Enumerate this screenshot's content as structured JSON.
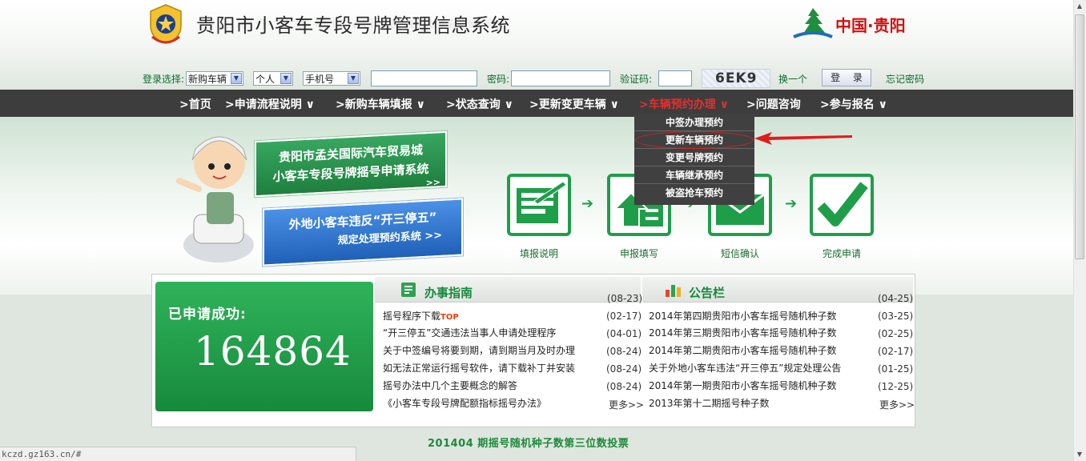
{
  "header": {
    "title": "贵阳市小客车专段号牌管理信息系统",
    "logo_text": "中国·贵阳",
    "icons": [
      "police-emblem-icon",
      "guiyang-logo-icon"
    ]
  },
  "login": {
    "select_label": "登录选择:",
    "vehicle_type": "新购车辆",
    "person_type": "个人",
    "id_type": "手机号",
    "password_label": "密码:",
    "captcha_label": "验证码:",
    "captcha_text": "6EK9",
    "refresh_label": "换一个",
    "login_button": "登 录",
    "forgot_label": "忘记密码"
  },
  "nav": {
    "items": [
      {
        "label": ">首页"
      },
      {
        "label": ">申请流程说明 ∨"
      },
      {
        "label": ">新购车辆填报 ∨"
      },
      {
        "label": ">状态查询 ∨"
      },
      {
        "label": ">更新变更车辆 ∨"
      },
      {
        "label": ">车辆预约办理 ∨"
      },
      {
        "label": ">问题咨询"
      },
      {
        "label": ">参与报名 ∨"
      }
    ],
    "active_index": 5,
    "dropdown": [
      "中签办理预约",
      "更新车辆预约",
      "变更号牌预约",
      "车辆继承预约",
      "被盗抢车预约"
    ],
    "highlight_index": 1
  },
  "banner": {
    "box1_line1": "贵阳市孟关国际汽车贸易城",
    "box1_line2": "小客车专段号牌摇号申请系统",
    "box1_arrow": ">>",
    "box2_line1": "外地小客车违反“开三停五”",
    "box2_line2": "规定处理预约系统 >>",
    "steps": [
      "填报说明",
      "申报填写",
      "短信确认",
      "完成申请"
    ],
    "step_arrow": "➔"
  },
  "stats": {
    "applied_label": "已申请成功:",
    "applied_count": "164864"
  },
  "guide": {
    "title": "办事指南",
    "header_date": "(08-23)",
    "items": [
      {
        "text": "摇号程序下载",
        "badge": "TOP",
        "date": "(02-17)"
      },
      {
        "text": "“开三停五”交通违法当事人申请处理程序",
        "badge": "",
        "date": "(04-01)"
      },
      {
        "text": "关于中签编号将要到期，请到期当月及时办理",
        "badge": "",
        "date": "(08-24)"
      },
      {
        "text": "如无法正常运行摇号软件，请下载补丁并安装",
        "badge": "",
        "date": "(08-24)"
      },
      {
        "text": "摇号办法中几个主要概念的解答",
        "badge": "",
        "date": "(08-24)"
      },
      {
        "text": "《小客车专段号牌配额指标摇号办法》",
        "badge": "",
        "date": ""
      }
    ],
    "more": "更多>>"
  },
  "notice": {
    "title": "公告栏",
    "header_date": "(04-25)",
    "items": [
      {
        "text": "2014年第四期贵阳市小客车摇号随机种子数",
        "date": "(03-25)"
      },
      {
        "text": "2014年第三期贵阳市小客车摇号随机种子数",
        "date": "(02-25)"
      },
      {
        "text": "2014年第二期贵阳市小客车摇号随机种子数",
        "date": "(02-17)"
      },
      {
        "text": "关于外地小客车违法“开三停五”规定处理公告",
        "date": "(01-25)"
      },
      {
        "text": "2014年第一期贵阳市小客车摇号随机种子数",
        "date": "(12-25)"
      },
      {
        "text": "2013年第十二期摇号种子数",
        "date": ""
      }
    ],
    "more": "更多>>"
  },
  "bottom_title": "201404 期摇号随机种子数第三位数投票",
  "status_bar": "kczd.gz163.cn/#",
  "colors": {
    "brand_green": "#1f9e4a",
    "nav_bg": "#3d3d3d",
    "active_red": "#e03030"
  }
}
